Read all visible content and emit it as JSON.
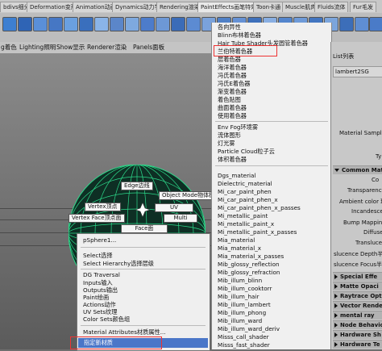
{
  "shelf_tabs": [
    "bdivs细分",
    "Deformation变形",
    "Animation动画",
    "Dynamics动力学",
    "Rendering渲染",
    "PaintEffects画笔特效",
    "Toon卡通",
    "Muscle肌肉",
    "Fluids流体",
    "Fur毛发"
  ],
  "panel_menu": [
    "g着色",
    "Lighting照明",
    "Show显示",
    "Renderer渲染",
    "Panels面板"
  ],
  "viewport": {
    "object_label": "pSphere1...",
    "marking_menu": {
      "edge": "Edge边线",
      "object_mode": "Object Mode物体模",
      "vertex": "Vertex顶点",
      "uv": "UV",
      "vertex_face": "Vertex Face顶点面",
      "multi": "Multi",
      "face": "Face面"
    }
  },
  "context_menu": {
    "select": "Select选择",
    "select_hierarchy": "Select Hierarchy选择层级",
    "dg_traversal": "DG Traversal",
    "inputs": "Inputs输入",
    "outputs": "Outputs输出",
    "paint": "Paint绘画",
    "actions": "Actions动作",
    "uv_sets": "UV Sets纹理",
    "color_sets": "Color Sets颜色组",
    "material_attributes": "Material Attributes材质属性...",
    "assign_material": "指定新材质"
  },
  "submenu": {
    "group1": [
      "各向异性",
      "Blinn布林着色器",
      "Hair Tube Shader头发圆管着色器",
      "兰伯特着色器",
      "层着色器",
      "海洋着色器",
      "冯氏着色器",
      "冯氏E着色器",
      "渐变着色器",
      "着色贴图",
      "曲面着色器",
      "使用着色器"
    ],
    "group2": [
      "Env Fog环境雾",
      "流体图形",
      "灯光雾",
      "Particle Cloud粒子云",
      "体积着色器"
    ],
    "group3": [
      "Dgs_material",
      "Dielectric_material",
      "Mi_car_paint_phen",
      "Mi_car_paint_phen_x",
      "Mi_car_paint_phen_x_passes",
      "Mi_metallic_paint",
      "Mi_metallic_paint_x",
      "Mi_metallic_paint_x_passes",
      "Mia_material",
      "Mia_material_x",
      "Mia_material_x_passes",
      "Mib_glossy_reflection",
      "Mib_glossy_refraction",
      "Mib_illum_blinn",
      "Mib_illum_cooktorr",
      "Mib_illum_hair",
      "Mib_illum_lambert",
      "Mib_illum_phong",
      "Mib_illum_ward",
      "Mib_illum_ward_deriv",
      "Misss_call_shader",
      "Misss_fast_shader"
    ]
  },
  "attribute_editor": {
    "header": "List列表",
    "tab": "lambert2SG",
    "sample_label": "Material Sample材质",
    "type_label": "Ty",
    "common_section": "Common Mate",
    "attrs": [
      "Co",
      "Transparency",
      "Ambient color 环境",
      "Incandescen",
      "Bump Mapping凹",
      "Diffuse",
      "Translucen",
      "slucence Depth半透",
      "slucence Focus半透"
    ],
    "sections": [
      "Special Effe",
      "Matte Opaci",
      "Raytrace Opt",
      "Vector Rende",
      "mental ray",
      "Node Behavio",
      "Hardware Sh",
      "Hardware Te"
    ]
  },
  "colors": {
    "highlight_box": "#e33333",
    "sphere_wire": "#2cd98a"
  }
}
